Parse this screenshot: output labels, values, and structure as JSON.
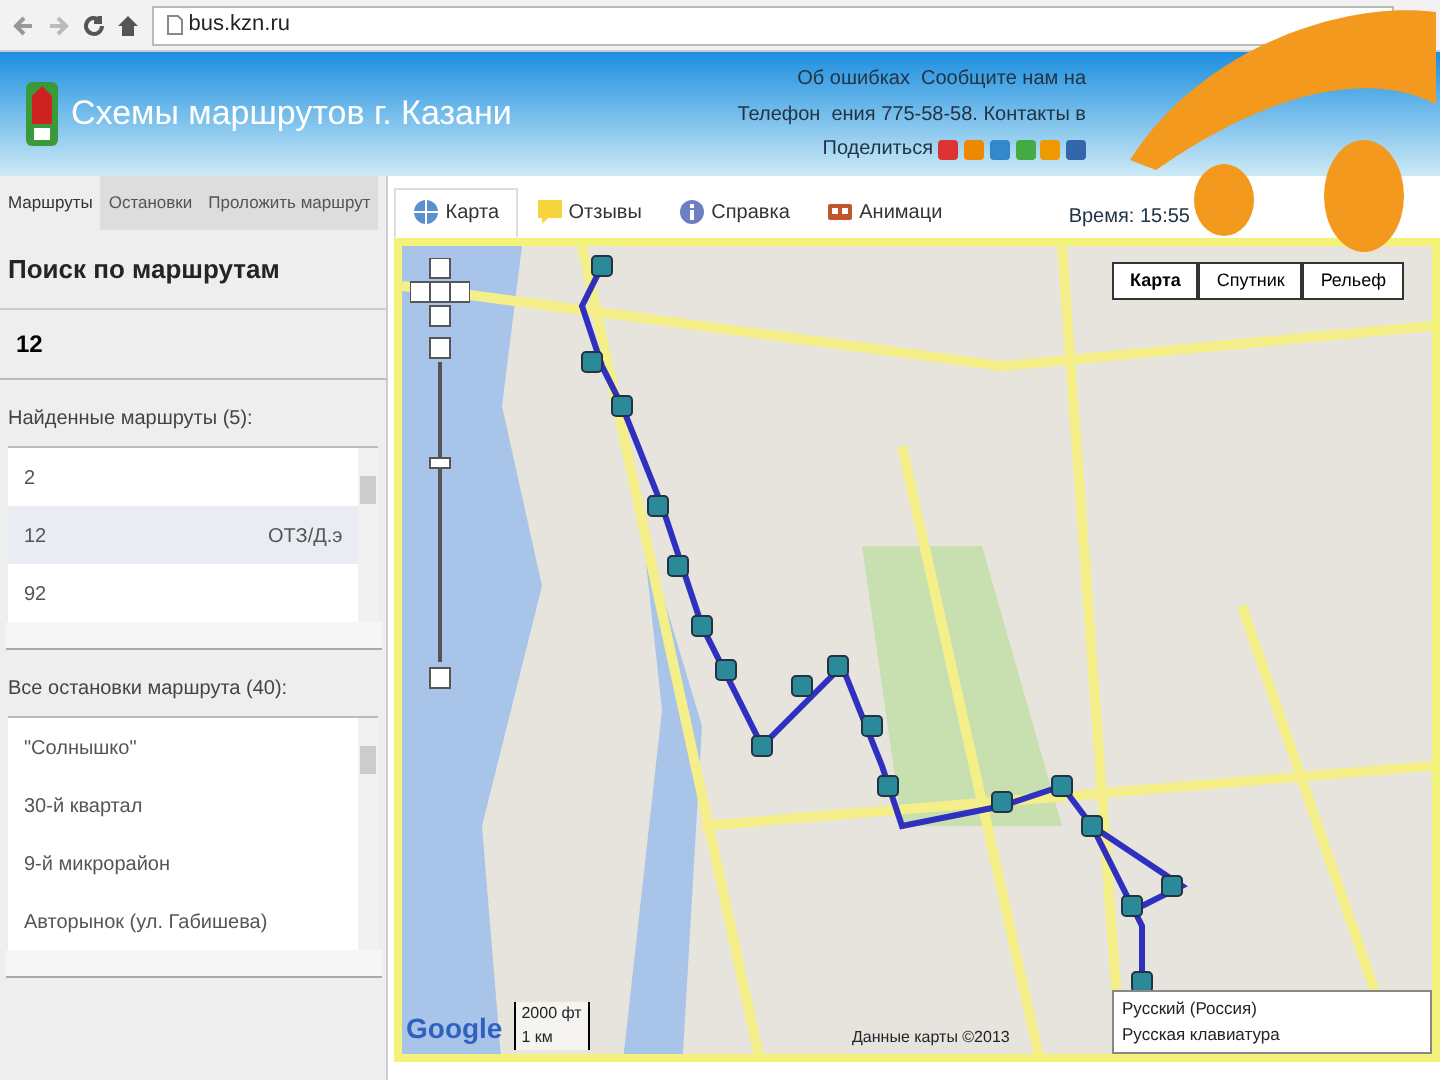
{
  "browser": {
    "url": "bus.kzn.ru"
  },
  "header": {
    "title": "Схемы маршрутов г. Казани",
    "notice": "Об ошибках",
    "notice_tail": "Сообщите нам на",
    "phone": "Телефон",
    "phone_tail": "ения 775-58-58. Контакты в",
    "share_label": "Поделиться"
  },
  "left_tabs": [
    {
      "label": "Маршруты",
      "selected": true
    },
    {
      "label": "Остановки",
      "selected": false
    },
    {
      "label": "Проложить маршрут",
      "selected": false
    }
  ],
  "search": {
    "heading": "Поиск по маршрутам",
    "value": "12"
  },
  "found": {
    "label": "Найденные маршруты",
    "count": "(5):",
    "items": [
      {
        "number": "2",
        "selected": false
      },
      {
        "number": "12",
        "note": "ОТЗ/Д.э",
        "selected": true
      },
      {
        "number": "92",
        "selected": false
      }
    ]
  },
  "stops": {
    "label": "Все остановки маршрута",
    "count": "(40):",
    "items": [
      "\"Солнышко\"",
      "30-й квартал",
      "9-й микрорайон",
      "Авторынок (ул. Габишева)"
    ]
  },
  "map_tabs": [
    {
      "label": "Карта",
      "selected": true
    },
    {
      "label": "Отзывы",
      "selected": false
    },
    {
      "label": "Справка",
      "selected": false
    },
    {
      "label": "Анимаци",
      "selected": false
    }
  ],
  "time": "Время: 15:55",
  "map_types": [
    {
      "label": "Карта",
      "selected": true
    },
    {
      "label": "Спутник",
      "selected": false
    },
    {
      "label": "Рельеф",
      "selected": false
    }
  ],
  "scale": [
    "2000 фт",
    "1 км"
  ],
  "logo": "Google",
  "attribution": "Данные карты ©2013",
  "language_popup": [
    "Русский (Россия)",
    "Русская клавиатура"
  ]
}
